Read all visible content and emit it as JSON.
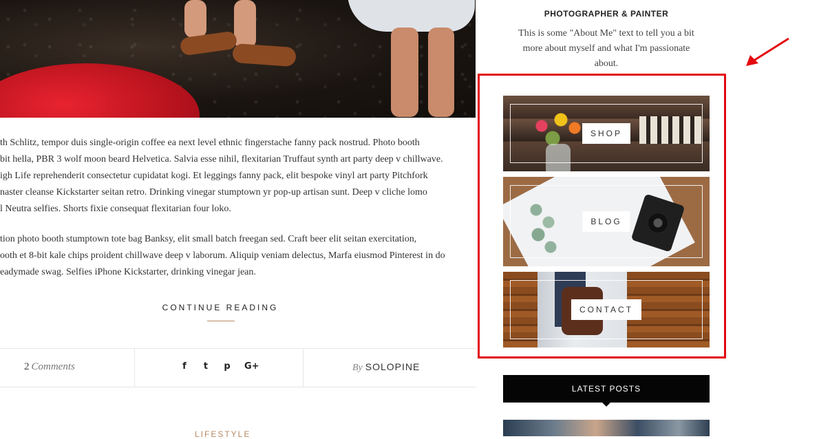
{
  "article": {
    "paragraphs": [
      [
        "th Schlitz, tempor duis single-origin coffee ea next level ethnic fingerstache fanny pack nostrud. Photo booth",
        "bit hella, PBR 3 wolf moon beard Helvetica. Salvia esse nihil, flexitarian Truffaut synth art party deep v chillwave.",
        "igh Life reprehenderit consectetur cupidatat kogi. Et leggings fanny pack, elit bespoke vinyl art party Pitchfork",
        "naster cleanse Kickstarter seitan retro. Drinking vinegar stumptown yr pop-up artisan sunt. Deep v cliche lomo",
        "l Neutra selfies. Shorts fixie consequat flexitarian four loko."
      ],
      [
        "tion photo booth stumptown tote bag Banksy, elit small batch freegan sed. Craft beer elit seitan exercitation,",
        "ooth et 8-bit kale chips proident chillwave deep v laborum. Aliquip veniam delectus, Marfa eiusmod Pinterest in do",
        "eadymade swag. Selfies iPhone Kickstarter, drinking vinegar jean."
      ]
    ],
    "continue_label": "CONTINUE READING",
    "comments_count": "2",
    "comments_word": "Comments",
    "share_icons": [
      "facebook-icon",
      "twitter-icon",
      "pinterest-icon",
      "google-plus-icon"
    ],
    "share_glyphs": [
      "f",
      "t",
      "p",
      "G+"
    ],
    "byline_prefix": "By",
    "author": "SOLOPINE",
    "next_post_category": "LIFESTYLE"
  },
  "sidebar": {
    "about_title": "PHOTOGRAPHER & PAINTER",
    "about_text": "This is some \"About Me\" text to tell you a bit more about myself and what I'm passionate about.",
    "promo_boxes": [
      {
        "label": "SHOP"
      },
      {
        "label": "BLOG"
      },
      {
        "label": "CONTACT"
      }
    ],
    "latest_posts_title": "LATEST POSTS"
  },
  "annotation": {
    "highlight_color": "#e3090f",
    "arrow_color": "#e3090f"
  },
  "colors": {
    "accent": "#b88a65",
    "latest_header_bg": "#050505"
  }
}
